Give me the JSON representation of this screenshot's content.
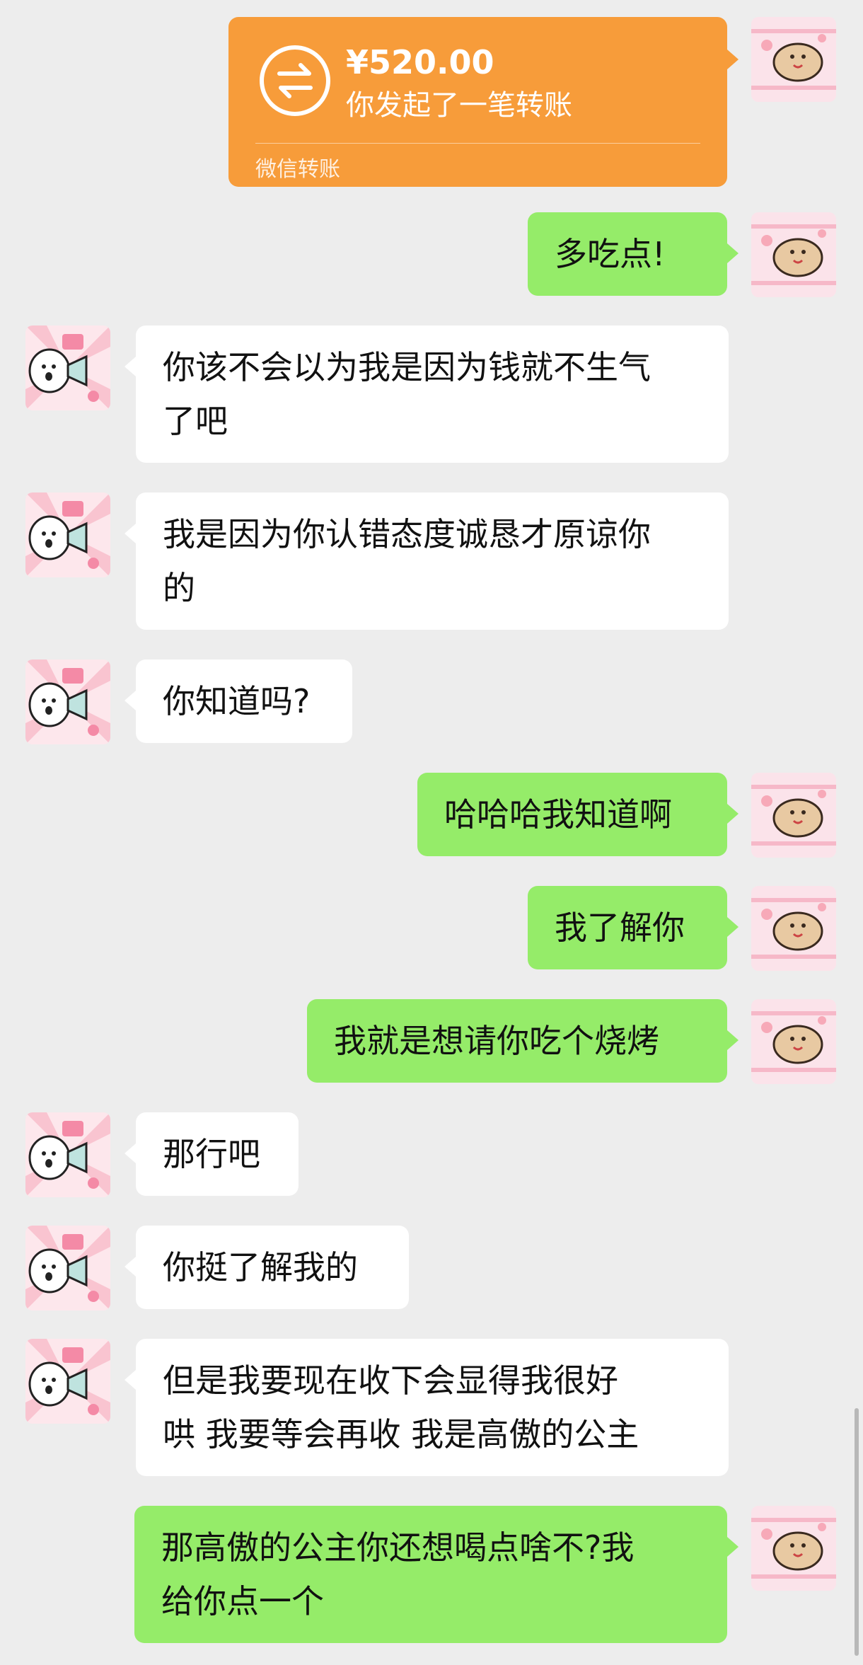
{
  "transfer": {
    "amount": "¥520.00",
    "description": "你发起了一笔转账",
    "footer": "微信转账",
    "color": "#f79c3a"
  },
  "messages": [
    {
      "sender": "me",
      "lines": [
        "多吃点!"
      ]
    },
    {
      "sender": "her",
      "lines": [
        "你该不会以为我是因为钱就不生气",
        "了吧"
      ]
    },
    {
      "sender": "her",
      "lines": [
        "我是因为你认错态度诚恳才原谅你",
        "的"
      ]
    },
    {
      "sender": "her",
      "lines": [
        "你知道吗?"
      ]
    },
    {
      "sender": "me",
      "lines": [
        "哈哈哈我知道啊"
      ]
    },
    {
      "sender": "me",
      "lines": [
        "我了解你"
      ]
    },
    {
      "sender": "me",
      "lines": [
        "我就是想请你吃个烧烤"
      ]
    },
    {
      "sender": "her",
      "lines": [
        "那行吧"
      ]
    },
    {
      "sender": "her",
      "lines": [
        "你挺了解我的"
      ]
    },
    {
      "sender": "her",
      "lines": [
        "但是我要现在收下会显得我很好",
        "哄 我要等会再收 我是高傲的公主"
      ]
    },
    {
      "sender": "me",
      "lines": [
        "那高傲的公主你还想喝点啥不?我",
        "给你点一个"
      ]
    }
  ],
  "colors": {
    "background": "#ededed",
    "my_bubble": "#95ec69",
    "her_bubble": "#ffffff"
  },
  "icons": {
    "my_avatar": "pig-sticker-avatar-icon",
    "her_avatar": "dog-megaphone-sticker-avatar-icon",
    "transfer": "transfer-arrows-icon"
  }
}
